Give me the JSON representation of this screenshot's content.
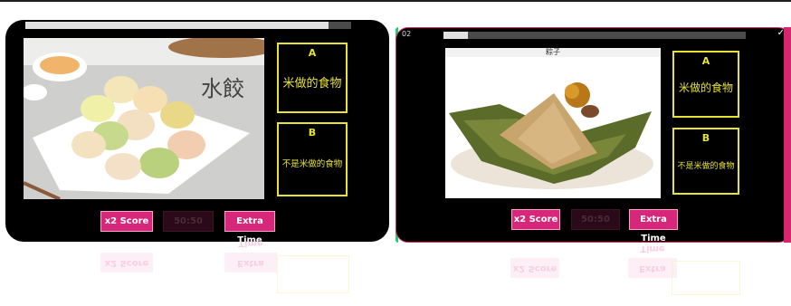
{
  "left_panel": {
    "progress": 0.93,
    "overlay_text": "水餃",
    "choices": [
      {
        "letter": "A",
        "text": "米做的食物"
      },
      {
        "letter": "B",
        "text": "不是米做的食物"
      }
    ],
    "powerups": {
      "x2": "x2 Score",
      "fifty": "50:50",
      "time": "Extra Time"
    }
  },
  "right_panel": {
    "timer": "02",
    "progress": 0.08,
    "caption": "粽子",
    "choices": [
      {
        "letter": "A",
        "text": "米做的食物"
      },
      {
        "letter": "B",
        "text": "不是米做的食物"
      }
    ],
    "powerups": {
      "x2": "x2 Score",
      "fifty": "50:50",
      "time": "Extra Time"
    }
  },
  "colors": {
    "accent": "#d6277a",
    "choice": "#e8e233",
    "screen": "#000000",
    "right_border": "#d7266e",
    "right_accent": "#1dcf6d"
  }
}
